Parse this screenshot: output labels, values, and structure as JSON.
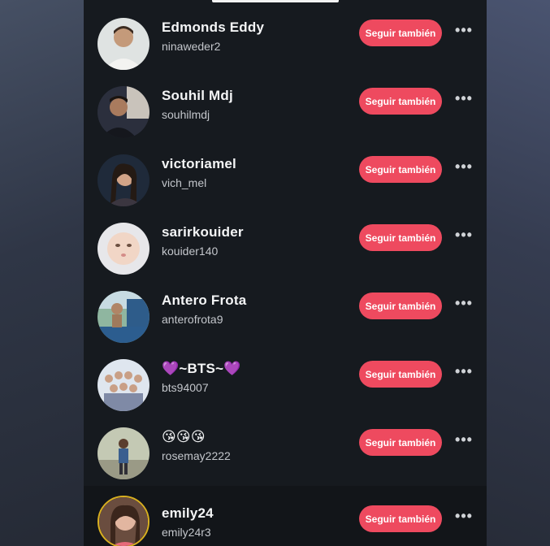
{
  "follow_list": [
    {
      "name": "Edmonds Eddy",
      "handle": "ninaweder2",
      "button": "Seguir también",
      "more": "•••"
    },
    {
      "name": "Souhil Mdj",
      "handle": "souhilmdj",
      "button": "Seguir también",
      "more": "•••"
    },
    {
      "name": "victoriamel",
      "handle": "vich_mel",
      "button": "Seguir también",
      "more": "•••"
    },
    {
      "name": "sarirkouider",
      "handle": "kouider140",
      "button": "Seguir también",
      "more": "•••"
    },
    {
      "name": "Antero Frota",
      "handle": "anterofrota9",
      "button": "Seguir también",
      "more": "•••"
    },
    {
      "name": "💜~BTS~💜",
      "handle": "bts94007",
      "button": "Seguir también",
      "more": "•••"
    },
    {
      "name": "😘😘😘",
      "handle": "rosemay2222",
      "button": "Seguir también",
      "more": "•••"
    },
    {
      "name": "emily24",
      "handle": "emily24r3",
      "button": "Seguir también",
      "more": "•••"
    }
  ],
  "colors": {
    "follow_button": "#ee4a5f",
    "background": "#161a1f",
    "name_text": "#f4f5f6",
    "handle_text": "#c3c6cb"
  },
  "icons": {
    "more": "more-options-icon",
    "avatar": "profile-avatar"
  }
}
